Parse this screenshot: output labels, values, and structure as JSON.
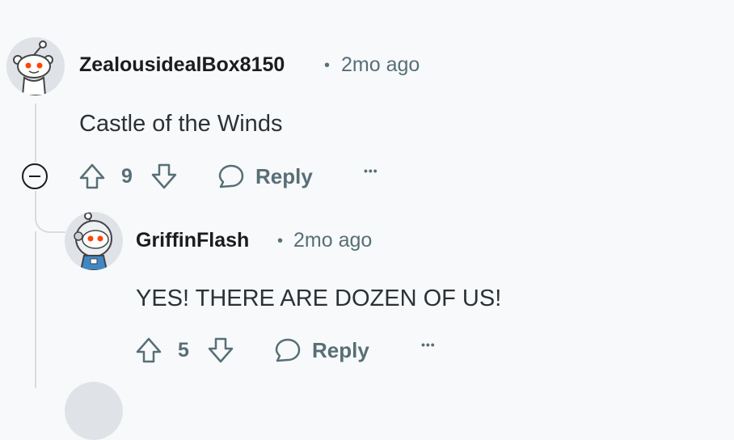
{
  "comments": [
    {
      "author": "ZealousidealBox8150",
      "separator": "•",
      "time": "2mo ago",
      "body": "Castle of the Winds",
      "votes": "9",
      "reply_label": "Reply",
      "more_label": "•••",
      "avatar_icon": "snoo-avatar-icon"
    },
    {
      "author": "GriffinFlash",
      "separator": "•",
      "time": "2mo ago",
      "body": "YES! THERE ARE DOZEN OF US!",
      "votes": "5",
      "reply_label": "Reply",
      "more_label": "•••",
      "avatar_icon": "snoo-astronaut-avatar-icon"
    }
  ],
  "colors": {
    "background": "#f8f9fb",
    "meta": "#576f76",
    "thread_line": "#d8dce1",
    "snoo_eye": "#ff4500",
    "astronaut_suit": "#3f88c5"
  }
}
